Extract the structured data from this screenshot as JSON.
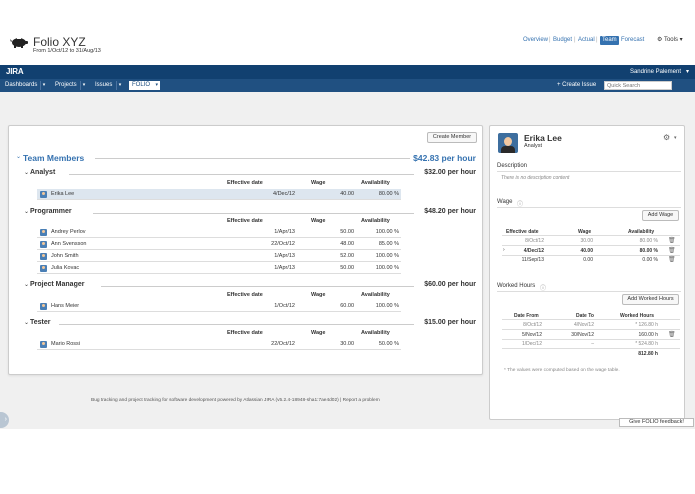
{
  "app": {
    "logo": "JIRA",
    "user_name": "Sandrine Palement"
  },
  "nav": {
    "dashboards": "Dashboards",
    "projects": "Projects",
    "issues": "Issues",
    "folio": "FOLIO",
    "create_issue": "+ Create Issue",
    "quick_search_placeholder": "Quick Search"
  },
  "header": {
    "title": "Folio XYZ",
    "subtitle": "From 1/Oct/12 to 31/Aug/13",
    "tabs": [
      "Overview",
      "Budget",
      "Actual",
      "Team",
      "Forecast"
    ],
    "active_tab": "Team",
    "tools_label": "Tools"
  },
  "team": {
    "create_member_label": "Create Member",
    "section_title": "Team Members",
    "section_rate": "$42.83 per hour",
    "col_date": "Effective date",
    "col_wage": "Wage",
    "col_avail": "Availability",
    "groups": [
      {
        "name": "Analyst",
        "rate": "$32.00 per hour",
        "members": [
          {
            "name": "Erika Lee",
            "date": "4/Dec/12",
            "wage": "40.00",
            "avail": "80.00 %"
          }
        ]
      },
      {
        "name": "Programmer",
        "rate": "$48.20 per hour",
        "members": [
          {
            "name": "Andrey Perlov",
            "date": "1/Apr/13",
            "wage": "50.00",
            "avail": "100.00 %"
          },
          {
            "name": "Ann Svensson",
            "date": "22/Oct/12",
            "wage": "48.00",
            "avail": "85.00 %"
          },
          {
            "name": "John Smith",
            "date": "1/Apr/13",
            "wage": "52.00",
            "avail": "100.00 %"
          },
          {
            "name": "Julia Kovac",
            "date": "1/Apr/13",
            "wage": "50.00",
            "avail": "100.00 %"
          }
        ]
      },
      {
        "name": "Project Manager",
        "rate": "$60.00 per hour",
        "members": [
          {
            "name": "Hans Meier",
            "date": "1/Oct/12",
            "wage": "60.00",
            "avail": "100.00 %"
          }
        ]
      },
      {
        "name": "Tester",
        "rate": "$15.00 per hour",
        "members": [
          {
            "name": "Mario Rossi",
            "date": "22/Oct/12",
            "wage": "30.00",
            "avail": "50.00 %"
          }
        ]
      }
    ]
  },
  "footer": {
    "text": "Bug tracking and project tracking for software development powered by Atlassian JIRA (v5.2.4-18948-sha1:7ae4d02)   |   Report a problem",
    "feedback": "Give FOLIO feedback!"
  },
  "sidebar": {
    "name": "Erika Lee",
    "role": "Analyst",
    "description_label": "Description",
    "description_text": "There is no description content",
    "wage_label": "Wage",
    "add_wage_label": "Add Wage",
    "wage_headers": [
      "Effective date",
      "Wage",
      "Availability"
    ],
    "wages": [
      {
        "date": "8/Oct/12",
        "wage": "30.00",
        "avail": "80.00 %",
        "style": "muted"
      },
      {
        "date": "4/Dec/12",
        "wage": "40.00",
        "avail": "80.00 %",
        "style": "bold"
      },
      {
        "date": "11/Sep/13",
        "wage": "0.00",
        "avail": "0.00 %",
        "style": "normal"
      }
    ],
    "worked_label": "Worked Hours",
    "add_worked_label": "Add Worked Hours",
    "worked_headers": [
      "Date From",
      "Date To",
      "Worked Hours"
    ],
    "worked": [
      {
        "from": "8/Oct/12",
        "to": "4/Nov/12",
        "hours": "* 126.80 h",
        "style": "muted"
      },
      {
        "from": "5/Nov/12",
        "to": "30/Nov/12",
        "hours": "160.00 h",
        "style": "normal"
      },
      {
        "from": "1/Dec/12",
        "to": "–",
        "hours": "* 524.80 h",
        "style": "muted"
      }
    ],
    "worked_total": "812.80 h",
    "footnote": "* The values were computed based on the wage table."
  }
}
